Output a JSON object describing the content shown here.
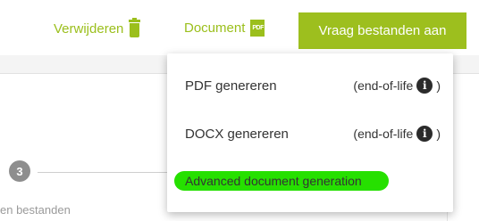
{
  "toolbar": {
    "delete_label": "Verwijderen",
    "delete_icon": "trash-icon",
    "document_label": "Document",
    "document_icon": "pdf-icon",
    "request_files_label": "Vraag bestanden aan",
    "accent_color": "#9bbf1c"
  },
  "background": {
    "step_number": "3",
    "step_label": "en bestanden"
  },
  "document_menu": {
    "items": [
      {
        "label": "PDF genereren",
        "suffix_open": "(end-of-life",
        "suffix_close": ")",
        "icon": "info-icon"
      },
      {
        "label": "DOCX genereren",
        "suffix_open": "(end-of-life",
        "suffix_close": ")",
        "icon": "info-icon"
      },
      {
        "label": "Advanced document generation",
        "highlight_color": "#26e000"
      }
    ]
  }
}
